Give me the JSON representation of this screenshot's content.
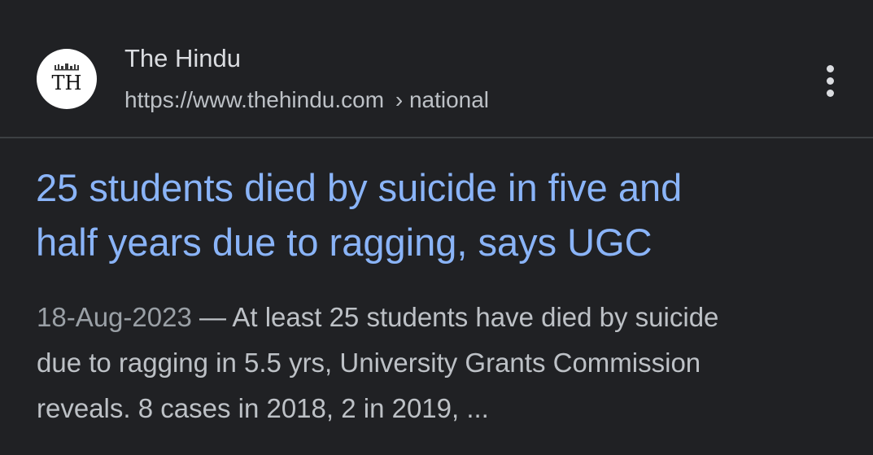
{
  "result": {
    "site": {
      "favicon_text": "TH",
      "name": "The Hindu",
      "url": "https://www.thehindu.com",
      "breadcrumb_sep": "›",
      "breadcrumb_path": "national"
    },
    "more_icon": "more-vert-icon",
    "title_lines": [
      "25 students died by suicide in five and",
      "half years due to ragging, says UGC"
    ],
    "snippet": {
      "date": "18-Aug-2023",
      "date_sep": " — ",
      "lines": [
        "At least 25 students have died by suicide",
        "due to ragging in 5.5 yrs, University Grants Commission",
        "reveals. 8 cases in 2018, 2 in 2019, ..."
      ]
    }
  },
  "colors": {
    "background": "#202124",
    "title_link": "#8ab4f8",
    "site_name": "#dadce0",
    "url": "#bdc1c6",
    "snippet": "#bdc1c6",
    "divider": "#3c4043"
  }
}
